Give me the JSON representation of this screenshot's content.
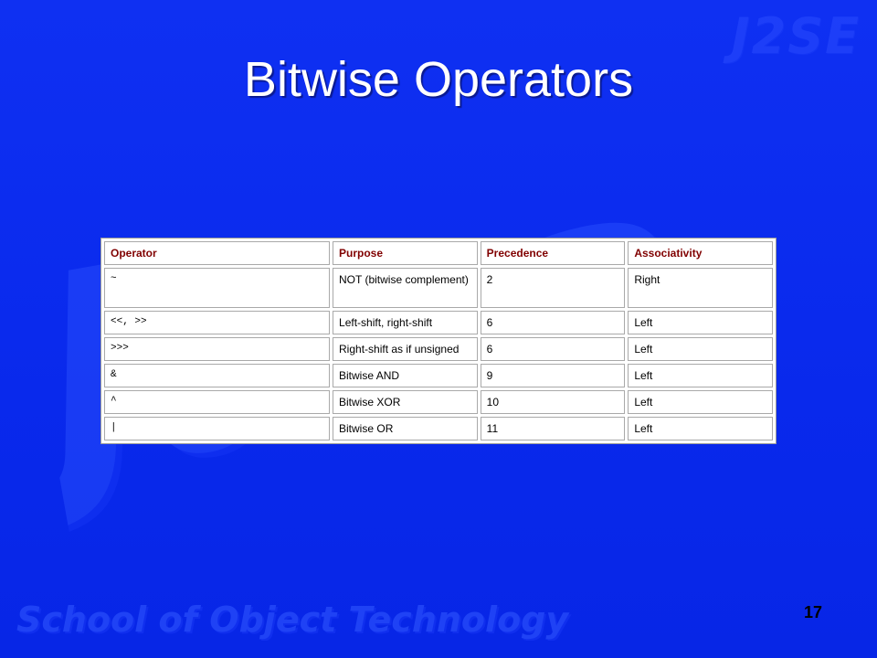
{
  "watermarks": {
    "brand": "J2SE",
    "big": "Java",
    "footer": "School of Object Technology"
  },
  "slide": {
    "title": "Bitwise Operators",
    "page_number": "17"
  },
  "table": {
    "headers": [
      "Operator",
      "Purpose",
      "Precedence",
      "Associativity"
    ],
    "rows": [
      {
        "operator": "~",
        "purpose": "NOT (bitwise complement)",
        "precedence": "2",
        "associativity": "Right"
      },
      {
        "operator": "<<, >>",
        "purpose": "Left-shift, right-shift",
        "precedence": "6",
        "associativity": "Left"
      },
      {
        "operator": ">>>",
        "purpose": "Right-shift as if unsigned",
        "precedence": "6",
        "associativity": "Left"
      },
      {
        "operator": "&",
        "purpose": "Bitwise AND",
        "precedence": "9",
        "associativity": "Left"
      },
      {
        "operator": "^",
        "purpose": "Bitwise XOR",
        "precedence": "10",
        "associativity": "Left"
      },
      {
        "operator": "|",
        "purpose": "Bitwise OR",
        "precedence": "11",
        "associativity": "Left"
      }
    ]
  },
  "colors": {
    "background": "#0a2df0",
    "header_text": "#800000",
    "title_text": "#ffffff"
  }
}
